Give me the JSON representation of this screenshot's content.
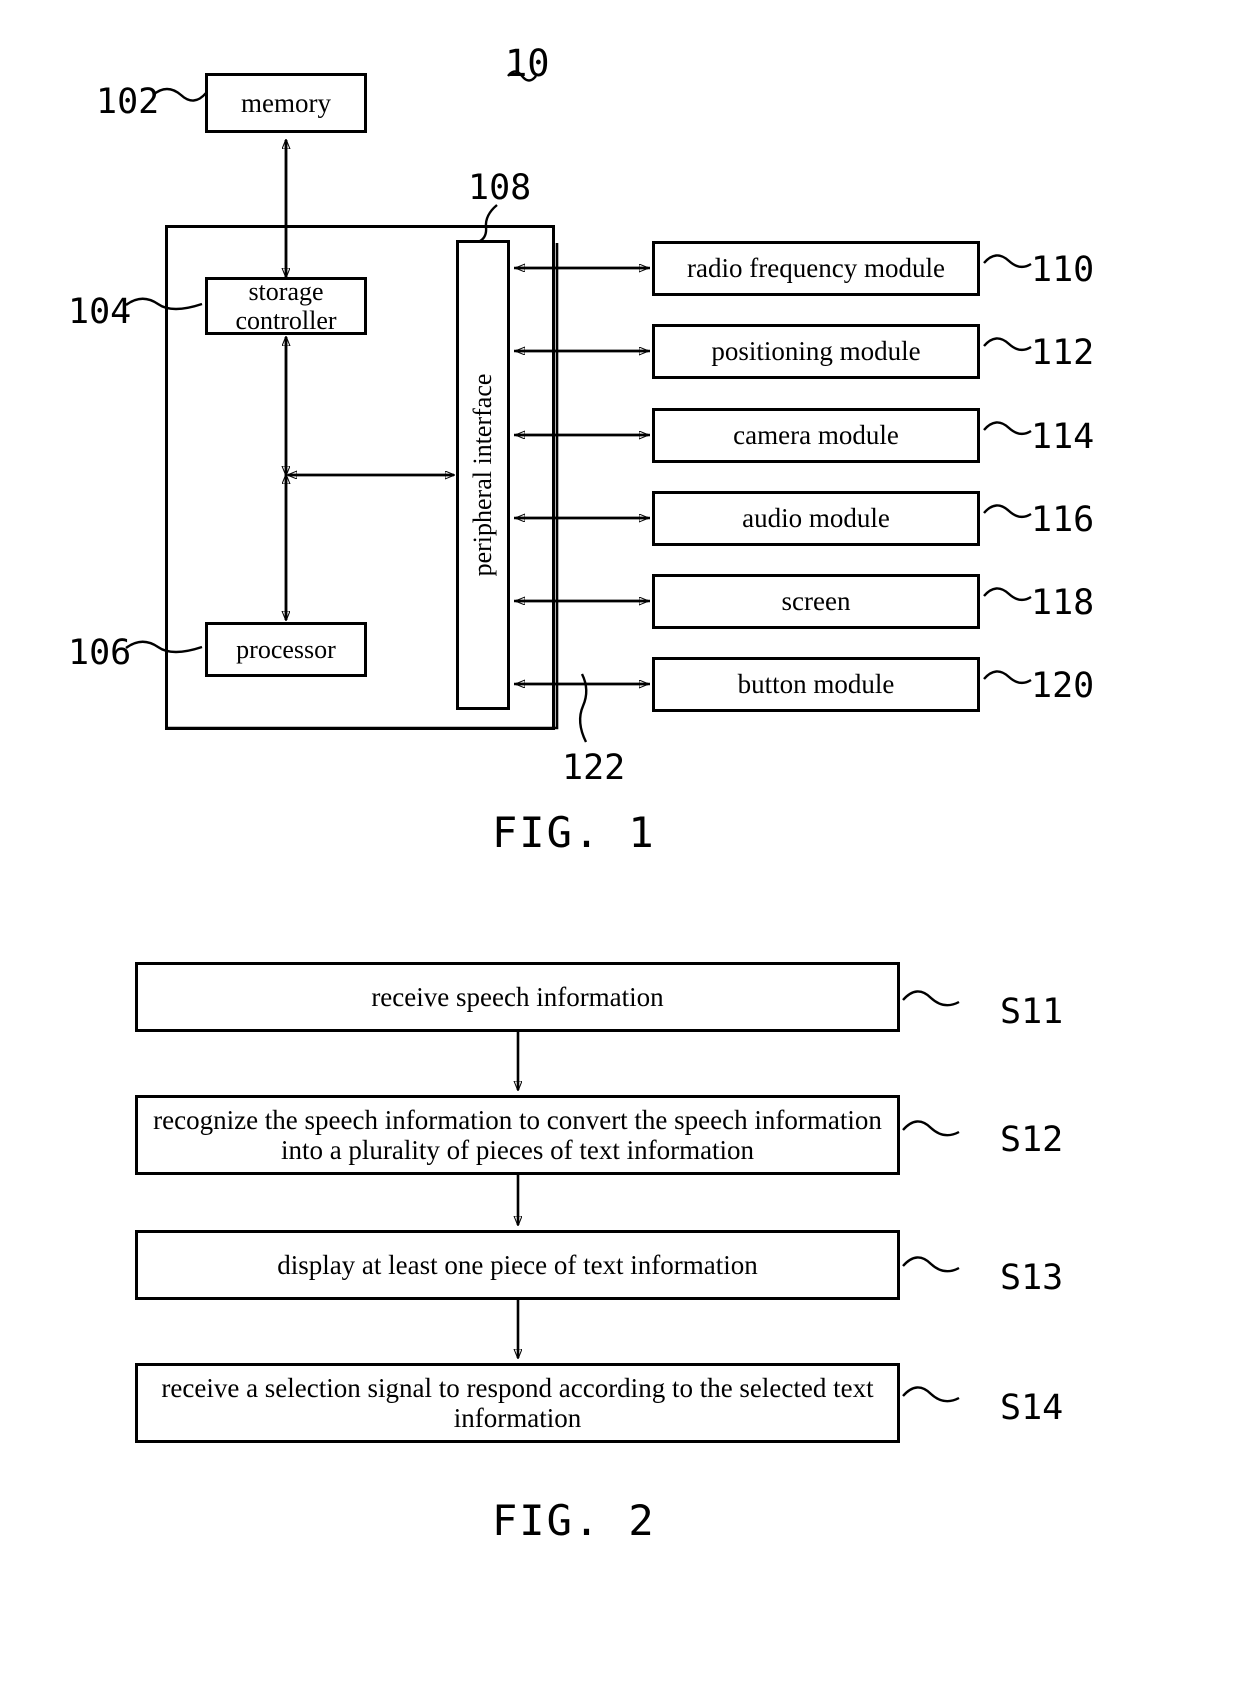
{
  "figure1": {
    "caption": "FIG.  1",
    "device_ref": "10",
    "blocks": {
      "memory": {
        "label": "memory",
        "ref": "102"
      },
      "storage_controller": {
        "label": "storage\ncontroller",
        "ref": "104"
      },
      "processor": {
        "label": "processor",
        "ref": "106"
      },
      "peripheral_interface": {
        "label": "peripheral interface",
        "ref": "108"
      },
      "bus": {
        "ref": "122"
      }
    },
    "modules": [
      {
        "label": "radio frequency module",
        "ref": "110"
      },
      {
        "label": "positioning module",
        "ref": "112"
      },
      {
        "label": "camera module",
        "ref": "114"
      },
      {
        "label": "audio module",
        "ref": "116"
      },
      {
        "label": "screen",
        "ref": "118"
      },
      {
        "label": "button module",
        "ref": "120"
      }
    ]
  },
  "figure2": {
    "caption": "FIG.  2",
    "steps": [
      {
        "text": "receive speech information",
        "ref": "S11"
      },
      {
        "text": "recognize the speech information to convert the speech information into a plurality of pieces of text information",
        "ref": "S12"
      },
      {
        "text": "display at least one piece of text information",
        "ref": "S13"
      },
      {
        "text": "receive a selection signal to respond according to the selected text information",
        "ref": "S14"
      }
    ]
  }
}
